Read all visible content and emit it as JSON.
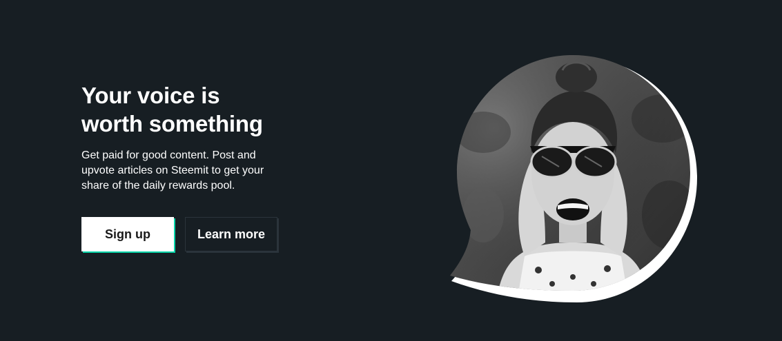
{
  "hero": {
    "headline_line1": "Your voice is",
    "headline_line2": "worth something",
    "description": "Get paid for good content. Post and upvote articles on Steemit to get your share of the daily rewards pool."
  },
  "buttons": {
    "signup_label": "Sign up",
    "learn_more_label": "Learn more"
  },
  "colors": {
    "background": "#171e23",
    "accent": "#06d6a9",
    "text": "#ffffff"
  },
  "image": {
    "subject": "smiling-woman-with-sunglasses-photo"
  }
}
